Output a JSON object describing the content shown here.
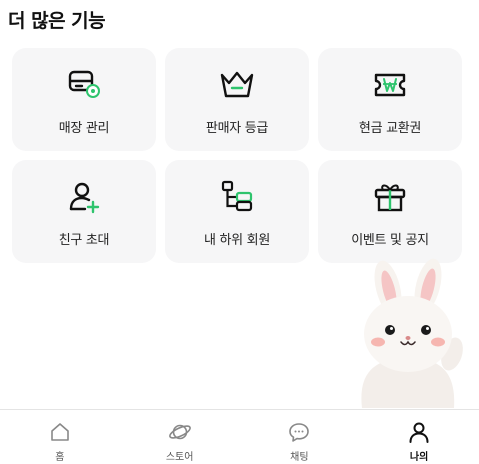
{
  "section": {
    "title": "더 많은 기능"
  },
  "features": [
    {
      "name": "store-manage",
      "label": "매장 관리",
      "icon": "store-settings-icon"
    },
    {
      "name": "seller-grade",
      "label": "판매자 등급",
      "icon": "crown-icon"
    },
    {
      "name": "cash-voucher",
      "label": "현금 교환권",
      "icon": "won-ticket-icon"
    },
    {
      "name": "invite-friends",
      "label": "친구 초대",
      "icon": "user-add-icon"
    },
    {
      "name": "sub-members",
      "label": "내 하위 회원",
      "icon": "hierarchy-icon"
    },
    {
      "name": "events-notices",
      "label": "이벤트 및 공지",
      "icon": "gift-icon"
    }
  ],
  "bottom_nav": {
    "items": [
      {
        "label": "홈",
        "icon": "home-icon",
        "active": false
      },
      {
        "label": "스토어",
        "icon": "planet-icon",
        "active": false
      },
      {
        "label": "채팅",
        "icon": "chat-bubble-icon",
        "active": false
      },
      {
        "label": "나의",
        "icon": "user-icon",
        "active": true
      }
    ]
  },
  "colors": {
    "accent_green": "#2ec46d",
    "card_bg": "#f6f6f7",
    "text_dark": "#111111"
  }
}
